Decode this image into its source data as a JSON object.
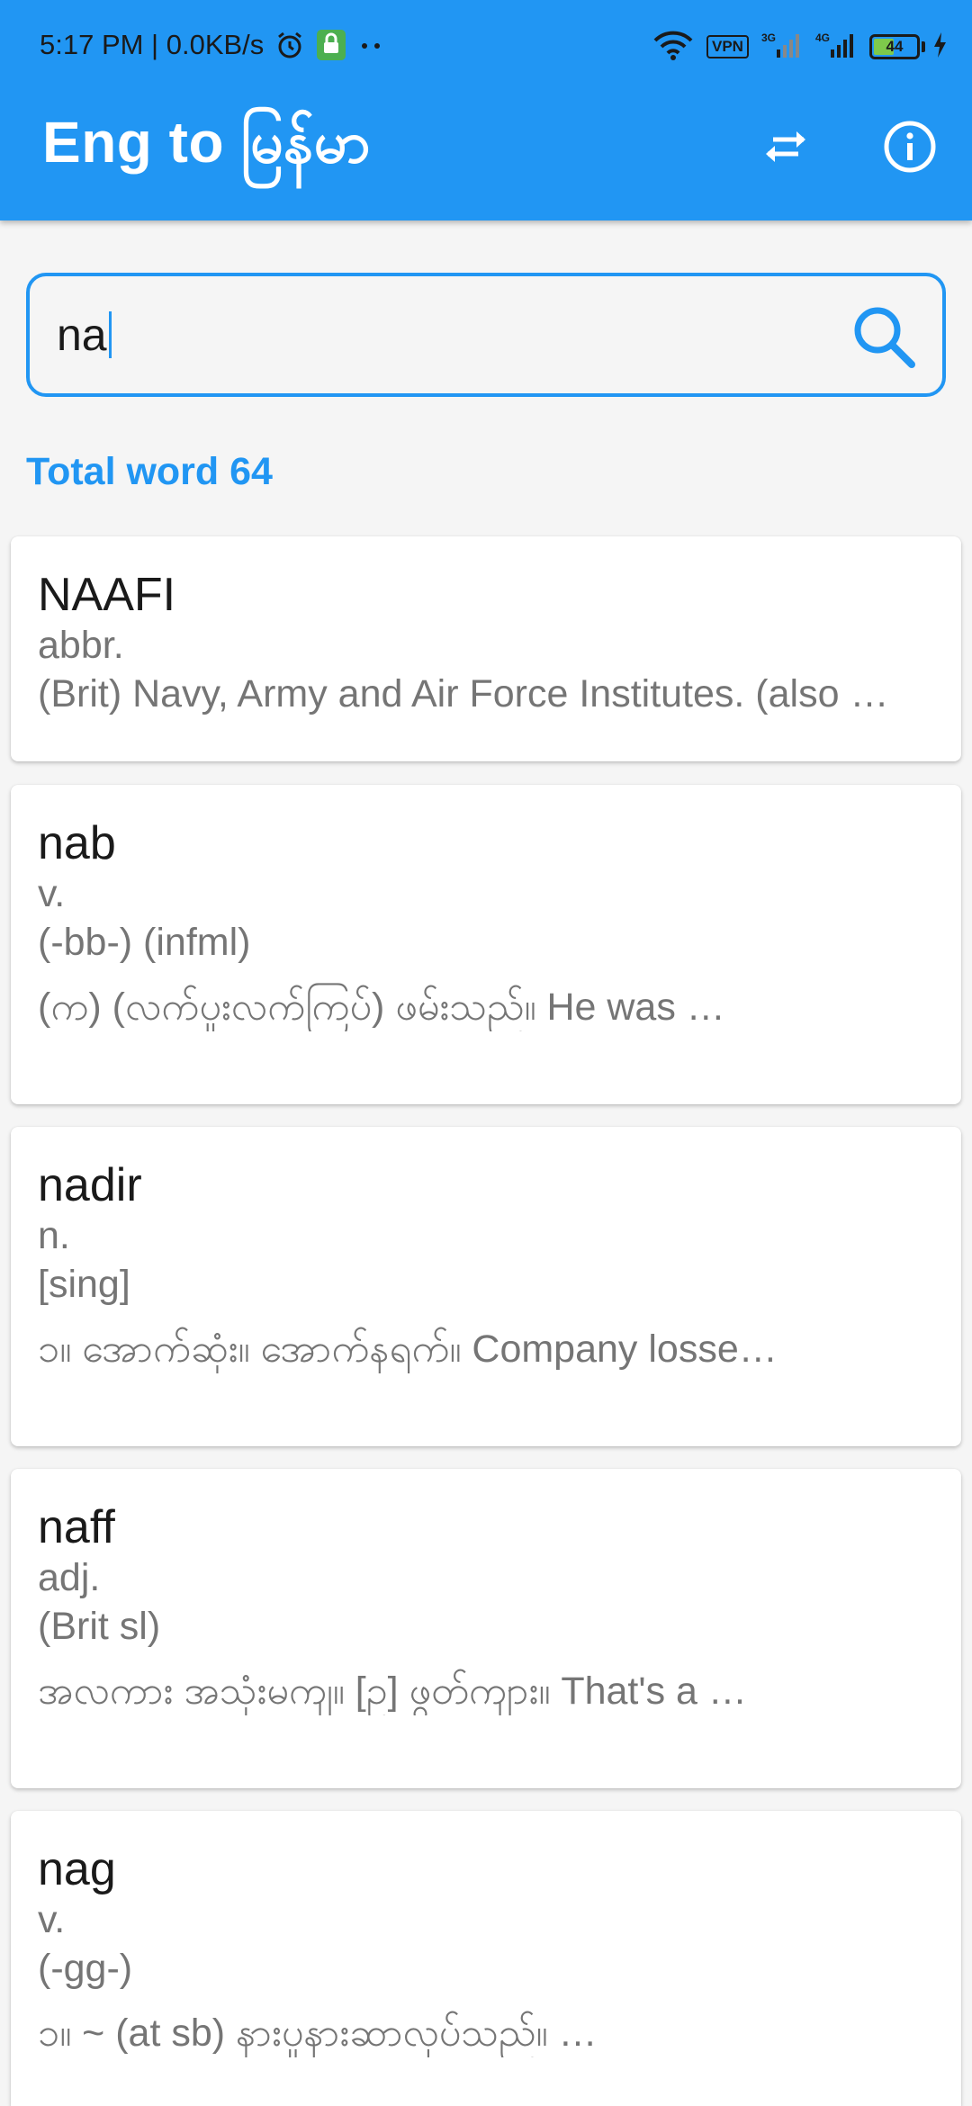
{
  "status_bar": {
    "time": "5:17 PM | 0.0KB/s",
    "vpn": "VPN",
    "net1": "3G",
    "net2": "4G",
    "battery": "44"
  },
  "app_bar": {
    "title": "Eng to မြန်မာ"
  },
  "search": {
    "value": "na"
  },
  "total_word": "Total word 64",
  "entries": [
    {
      "word": "NAAFI",
      "pos": "abbr.",
      "meaning": "(Brit) Navy, Army and Air Force Institutes. (also …"
    },
    {
      "word": "nab",
      "pos": "v.",
      "note": "(-bb-) (infml)",
      "meaning": "(က) (လက်ပူးလက်ကြပ်) ဖမ်းသည်။ He was …"
    },
    {
      "word": "nadir",
      "pos": "n.",
      "note": "[sing]",
      "meaning": "၁။ အောက်ဆုံး။ အောက်နရက်။ Company losse…"
    },
    {
      "word": "naff",
      "pos": "adj.",
      "note": "(Brit sl)",
      "meaning": "အလကား အသုံးမကျ။ [ဥ] ဖွတ်ကျား။ That's a …"
    },
    {
      "word": "nag",
      "pos": "v.",
      "note": "(-gg-)",
      "meaning": "၁။ ~ (at sb) နားပူနားဆာလုပ်သည်။ …"
    }
  ],
  "colors": {
    "primary": "#2196F3",
    "background": "#f5f5f5",
    "card": "#ffffff",
    "secondary_text": "#757575"
  }
}
